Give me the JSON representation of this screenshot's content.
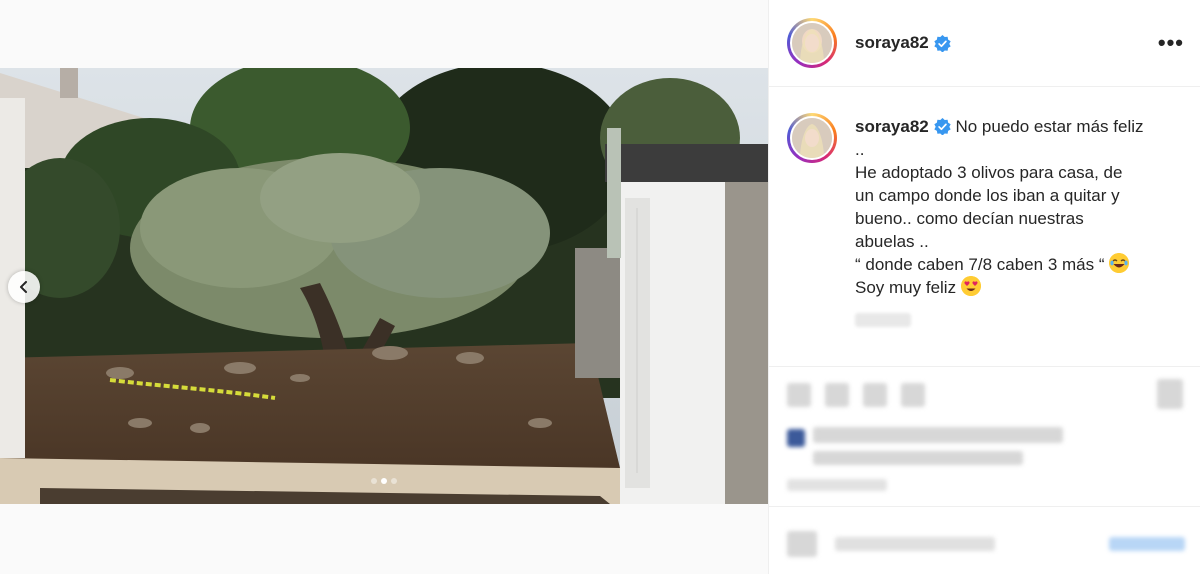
{
  "post": {
    "username": "soraya82",
    "verified": true,
    "more_label": "•••",
    "caption_lines": [
      "No puedo estar más feliz",
      "..",
      "He adoptado 3 olivos para casa, de",
      "un campo donde los iban a quitar y",
      "bueno.. como decían nuestras",
      "abuelas ..",
      "“ donde caben 7/8 caben 3 más “",
      "Soy muy feliz"
    ],
    "emojis": [
      "laughing-face-emoji",
      "heart-eyes-emoji"
    ]
  },
  "carousel": {
    "dots": 3,
    "active_dot": 2
  },
  "colors": {
    "verified": "#3897f0",
    "border": "#efefef",
    "text": "#262626"
  },
  "icons": [
    "chevron-left-icon",
    "verified-badge-icon",
    "more-options-icon"
  ]
}
